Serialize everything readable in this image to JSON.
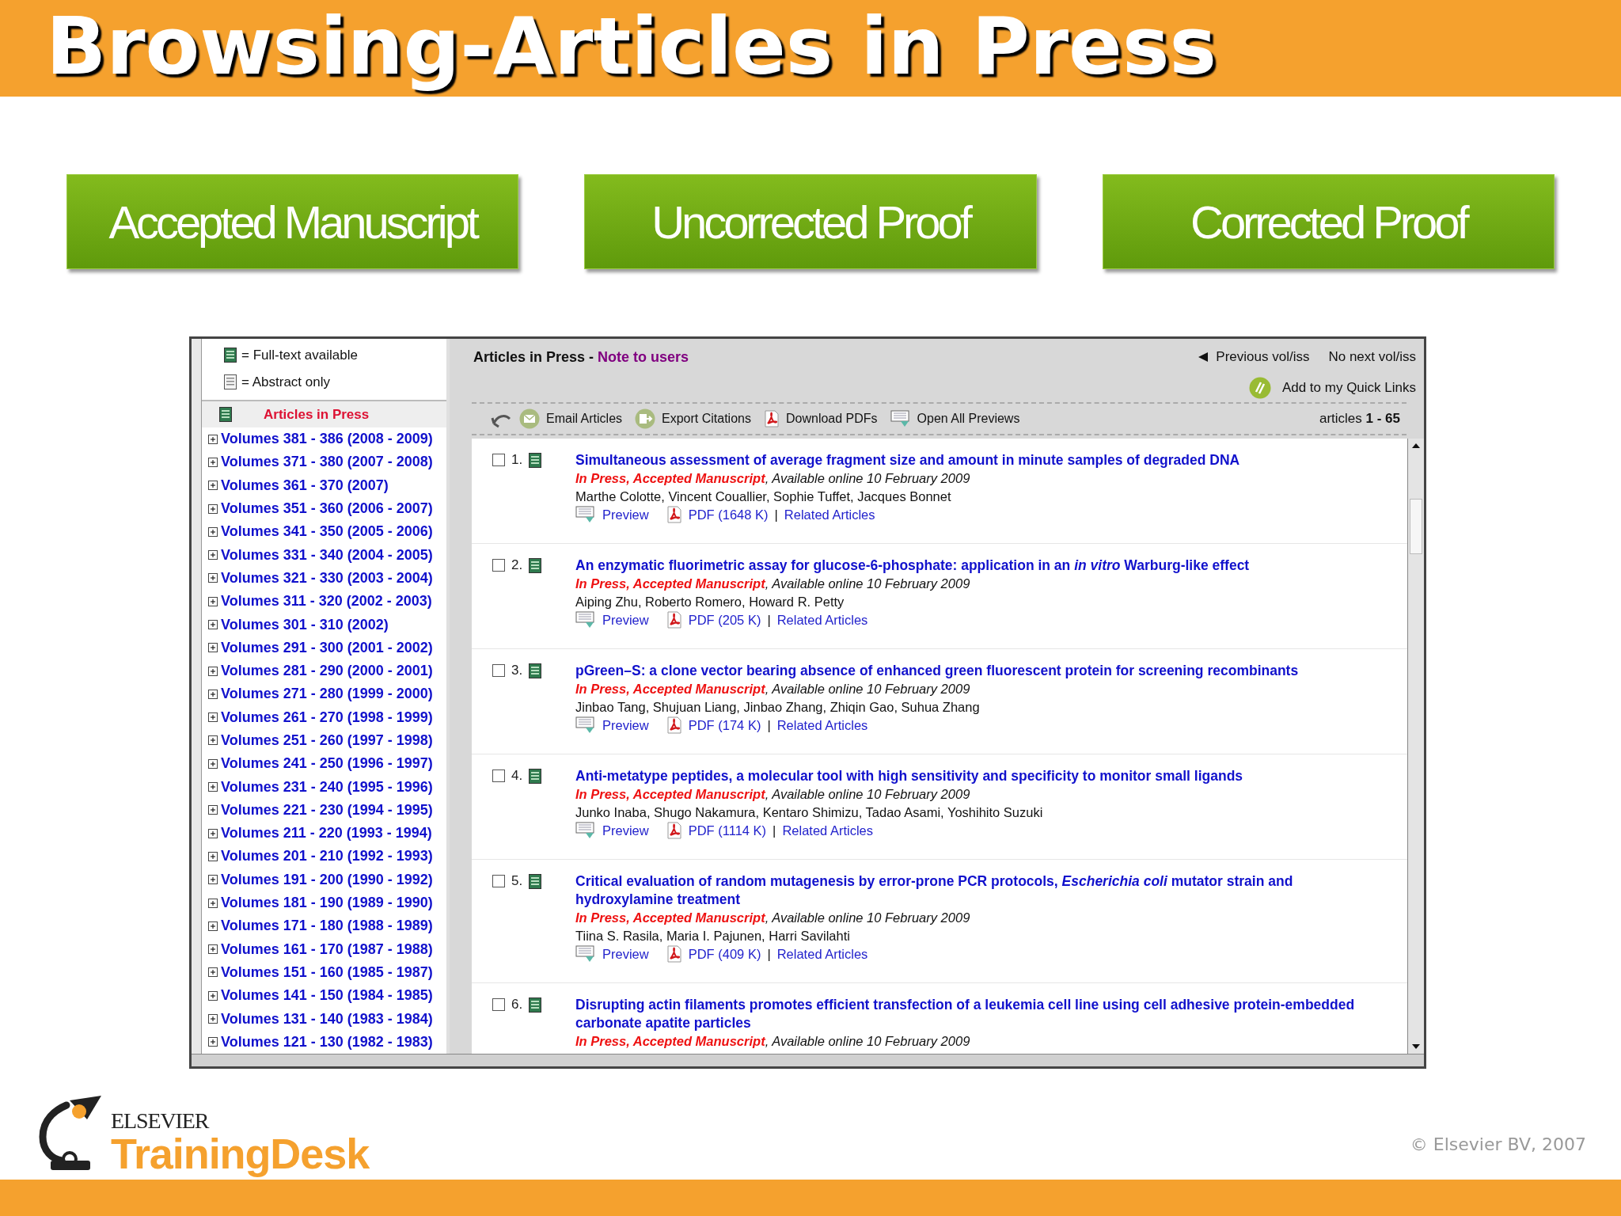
{
  "slide": {
    "title": "Browsing-Articles in Press",
    "copyright": "© Elsevier BV, 2007"
  },
  "stages": [
    {
      "label": "Accepted Manuscript"
    },
    {
      "label": "Uncorrected Proof"
    },
    {
      "label": "Corrected Proof"
    }
  ],
  "sidebar": {
    "legend": [
      {
        "kind": "full_text",
        "label": "= Full-text available"
      },
      {
        "kind": "abstract",
        "label": "= Abstract only"
      }
    ],
    "current": {
      "label": "Articles in Press",
      "selected": true
    },
    "volumes": [
      {
        "label": "Volumes 381 - 386 (2008 - 2009)",
        "expanded": false
      },
      {
        "label": "Volumes 371 - 380 (2007 - 2008)",
        "expanded": false
      },
      {
        "label": "Volumes 361 - 370 (2007)",
        "expanded": false
      },
      {
        "label": "Volumes 351 - 360 (2006 - 2007)",
        "expanded": false
      },
      {
        "label": "Volumes 341 - 350 (2005 - 2006)",
        "expanded": false
      },
      {
        "label": "Volumes 331 - 340 (2004 - 2005)",
        "expanded": false
      },
      {
        "label": "Volumes 321 - 330 (2003 - 2004)",
        "expanded": false
      },
      {
        "label": "Volumes 311 - 320 (2002 - 2003)",
        "expanded": false
      },
      {
        "label": "Volumes 301 - 310 (2002)",
        "expanded": false
      },
      {
        "label": "Volumes 291 - 300 (2001 - 2002)",
        "expanded": false
      },
      {
        "label": "Volumes 281 - 290 (2000 - 2001)",
        "expanded": false
      },
      {
        "label": "Volumes 271 - 280 (1999 - 2000)",
        "expanded": false
      },
      {
        "label": "Volumes 261 - 270 (1998 - 1999)",
        "expanded": false
      },
      {
        "label": "Volumes 251 - 260 (1997 - 1998)",
        "expanded": false
      },
      {
        "label": "Volumes 241 - 250 (1996 - 1997)",
        "expanded": false
      },
      {
        "label": "Volumes 231 - 240 (1995 - 1996)",
        "expanded": false
      },
      {
        "label": "Volumes 221 - 230 (1994 - 1995)",
        "expanded": false
      },
      {
        "label": "Volumes 211 - 220 (1993 - 1994)",
        "expanded": false
      },
      {
        "label": "Volumes 201 - 210 (1992 - 1993)",
        "expanded": false
      },
      {
        "label": "Volumes 191 - 200 (1990 - 1992)",
        "expanded": false
      },
      {
        "label": "Volumes 181 - 190 (1989 - 1990)",
        "expanded": false
      },
      {
        "label": "Volumes 171 - 180 (1988 - 1989)",
        "expanded": false
      },
      {
        "label": "Volumes 161 - 170 (1987 - 1988)",
        "expanded": false
      },
      {
        "label": "Volumes 151 - 160 (1985 - 1987)",
        "expanded": false
      },
      {
        "label": "Volumes 141 - 150 (1984 - 1985)",
        "expanded": false
      },
      {
        "label": "Volumes 131 - 140 (1983 - 1984)",
        "expanded": false
      },
      {
        "label": "Volumes 121 - 130 (1982 - 1983)",
        "expanded": false
      }
    ]
  },
  "header": {
    "title": "Articles in Press",
    "separator": "-",
    "note_link": "Note to users",
    "previous": "Previous vol/iss",
    "next": "No next vol/iss",
    "quick_links": "Add to my Quick Links"
  },
  "toolbar": {
    "actions": [
      {
        "kind": "email",
        "label": "Email Articles"
      },
      {
        "kind": "export",
        "label": "Export Citations"
      },
      {
        "kind": "pdf",
        "label": "Download PDFs"
      },
      {
        "kind": "preview",
        "label": "Open All Previews"
      }
    ],
    "count": "articles **1 - 65**"
  },
  "articles": [
    {
      "number": "1.",
      "checked": false,
      "full_text": true,
      "title": "Simultaneous assessment of average fragment size and amount in minute samples of degraded DNA",
      "status": "In Press, Accepted Manuscript",
      "availability": ", Available online 10 February 2009",
      "authors": "Marthe Colotte, Vincent Couallier, Sophie Tuffet, Jacques Bonnet",
      "links": {
        "preview": "Preview",
        "pdf": "PDF (1648 K)",
        "separator": "|",
        "related": "Related Articles"
      }
    },
    {
      "number": "2.",
      "checked": false,
      "full_text": true,
      "title": "An enzymatic fluorimetric assay for glucose-6-phosphate: application in an *in vitro* Warburg-like effect",
      "status": "In Press, Accepted Manuscript",
      "availability": ", Available online 10 February 2009",
      "authors": "Aiping Zhu, Roberto Romero, Howard R. Petty",
      "links": {
        "preview": "Preview",
        "pdf": "PDF (205 K)",
        "separator": "|",
        "related": "Related Articles"
      }
    },
    {
      "number": "3.",
      "checked": false,
      "full_text": true,
      "title": "pGreen–S: a clone vector bearing absence of enhanced green fluorescent protein for screening recombinants",
      "status": "In Press, Accepted Manuscript",
      "availability": ", Available online 10 February 2009",
      "authors": "Jinbao Tang, Shujuan Liang, Jinbao Zhang, Zhiqin Gao, Suhua Zhang",
      "links": {
        "preview": "Preview",
        "pdf": "PDF (174 K)",
        "separator": "|",
        "related": "Related Articles"
      }
    },
    {
      "number": "4.",
      "checked": false,
      "full_text": true,
      "title": "Anti-metatype peptides, a molecular tool with high sensitivity and specificity to monitor small ligands",
      "status": "In Press, Accepted Manuscript",
      "availability": ", Available online 10 February 2009",
      "authors": "Junko Inaba, Shugo Nakamura, Kentaro Shimizu, Tadao Asami, Yoshihito Suzuki",
      "links": {
        "preview": "Preview",
        "pdf": "PDF (1114 K)",
        "separator": "|",
        "related": "Related Articles"
      }
    },
    {
      "number": "5.",
      "checked": false,
      "full_text": true,
      "title": "Critical evaluation of random mutagenesis by error-prone PCR protocols, *Escherichia coli* mutator strain and hydroxylamine treatment",
      "status": "In Press, Accepted Manuscript",
      "availability": ", Available online 10 February 2009",
      "authors": "Tiina S. Rasila, Maria I. Pajunen, Harri Savilahti",
      "links": {
        "preview": "Preview",
        "pdf": "PDF (409 K)",
        "separator": "|",
        "related": "Related Articles"
      }
    },
    {
      "number": "6.",
      "checked": false,
      "full_text": true,
      "title": "Disrupting actin filaments promotes efficient transfection of a leukemia cell line using cell adhesive protein-embedded carbonate apatite particles",
      "status": "In Press, Accepted Manuscript",
      "availability": ", Available online 10 February 2009"
    }
  ],
  "logo": {
    "publisher": "ELSEVIER",
    "product": "TrainingDesk"
  }
}
